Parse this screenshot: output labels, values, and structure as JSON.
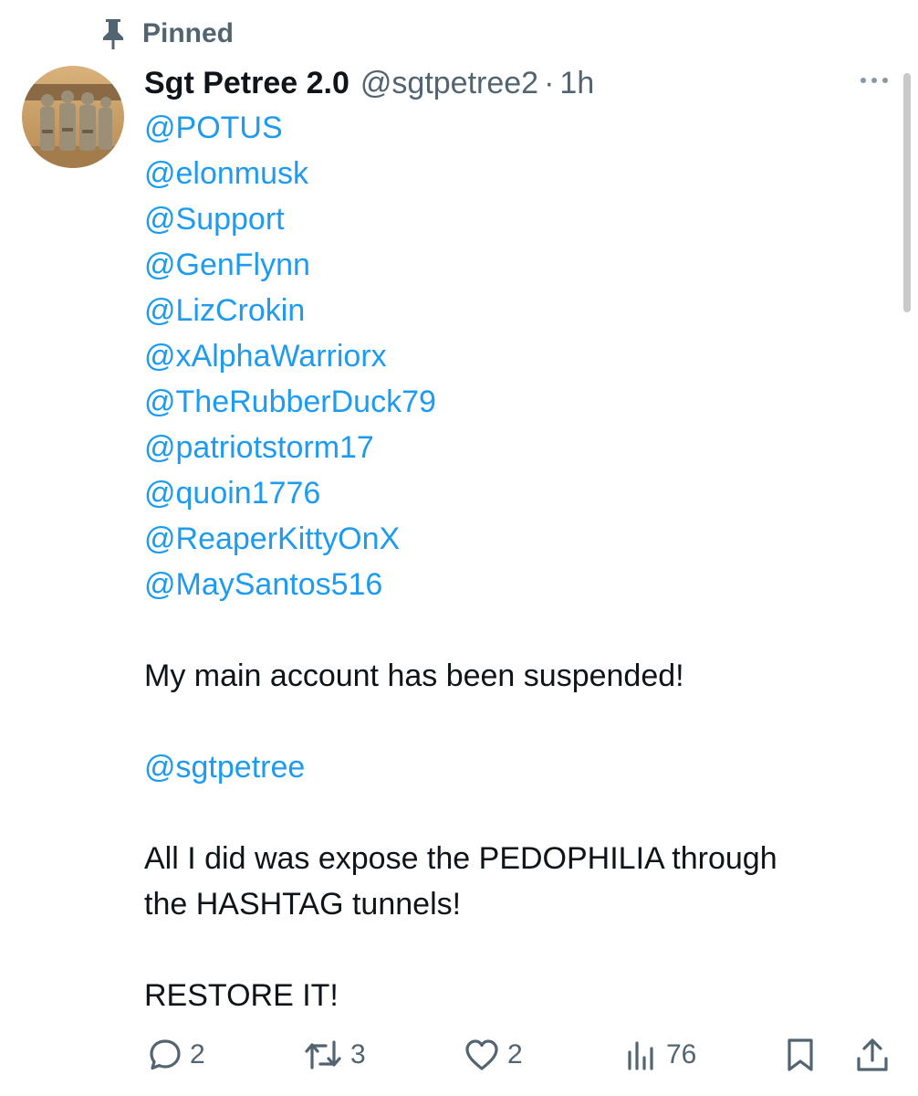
{
  "pinned": {
    "label": "Pinned",
    "icon": "pin-icon"
  },
  "author": {
    "display_name": "Sgt Petree 2.0",
    "handle": "@sgtpetree2",
    "separator": "·",
    "time": "1h"
  },
  "tweet": {
    "mentions": [
      "@POTUS",
      "@elonmusk",
      "@Support",
      "@GenFlynn",
      "@LizCrokin",
      "@xAlphaWarriorx",
      "@TheRubberDuck79",
      "@patriotstorm17",
      "@quoin1776",
      "@ReaperKittyOnX",
      "@MaySantos516"
    ],
    "paragraph_1": "My main account has been suspended!",
    "linked_handle": "@sgtpetree",
    "paragraph_2_line_1": "All I did was expose the PEDOPHILIA through",
    "paragraph_2_line_2": "the HASHTAG tunnels!",
    "paragraph_3": "RESTORE IT!"
  },
  "actions": {
    "replies": "2",
    "reposts": "3",
    "likes": "2",
    "views": "76"
  },
  "colors": {
    "text": "#0f1419",
    "secondary": "#536471",
    "link": "#1d9bf0",
    "background": "#ffffff"
  }
}
